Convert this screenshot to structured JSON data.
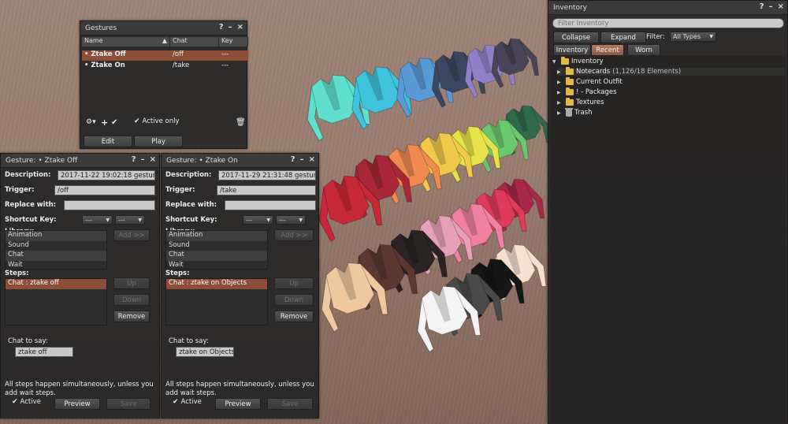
{
  "gestures_window": {
    "title": "Gestures",
    "columns": [
      "Name",
      "Chat",
      "Key"
    ],
    "rows": [
      {
        "name": "• Ztake Off",
        "chat": "/off",
        "key": "---"
      },
      {
        "name": "• Ztake On",
        "chat": "/take",
        "key": "---"
      }
    ],
    "active_only_label": "Active only",
    "edit_label": "Edit",
    "play_label": "Play"
  },
  "gesture_off": {
    "title": "Gesture: • Ztake Off",
    "description_label": "Description:",
    "description_value": "2017-11-22 19:02:18 gesture",
    "trigger_label": "Trigger:",
    "trigger_value": "/off",
    "replace_label": "Replace with:",
    "replace_value": "",
    "shortcut_label": "Shortcut Key:",
    "shortcut_mod": "---",
    "shortcut_key": "---",
    "library_label": "Library:",
    "library_items": [
      "Animation",
      "Sound",
      "Chat",
      "Wait"
    ],
    "add_label": "Add >>",
    "steps_label": "Steps:",
    "steps_items": [
      "Chat : ztake off"
    ],
    "up_label": "Up",
    "down_label": "Down",
    "remove_label": "Remove",
    "chat_to_say_label": "Chat to say:",
    "chat_to_say_value": "ztake off",
    "note": "All steps happen simultaneously, unless you add wait steps.",
    "active_label": "Active",
    "preview_label": "Preview",
    "save_label": "Save"
  },
  "gesture_on": {
    "title": "Gesture: • Ztake On",
    "description_label": "Description:",
    "description_value": "2017-11-29 21:31:48 gesture",
    "trigger_label": "Trigger:",
    "trigger_value": "/take",
    "replace_label": "Replace with:",
    "replace_value": "",
    "shortcut_label": "Shortcut Key:",
    "shortcut_mod": "---",
    "shortcut_key": "---",
    "library_label": "Library:",
    "library_items": [
      "Animation",
      "Sound",
      "Chat",
      "Wait"
    ],
    "add_label": "Add >>",
    "steps_label": "Steps:",
    "steps_items": [
      "Chat : ztake on Objects"
    ],
    "up_label": "Up",
    "down_label": "Down",
    "remove_label": "Remove",
    "chat_to_say_label": "Chat to say:",
    "chat_to_say_value": "ztake on Objects",
    "note": "All steps happen simultaneously, unless you add wait steps.",
    "active_label": "Active",
    "preview_label": "Preview",
    "save_label": "Save"
  },
  "inventory": {
    "title": "Inventory",
    "filter_placeholder": "Filter Inventory",
    "collapse_label": "Collapse",
    "expand_label": "Expand",
    "filter_label": "Filter:",
    "filter_value": "All Types",
    "tabs": [
      "Inventory",
      "Recent",
      "Worn"
    ],
    "root_label": "Inventory",
    "folders": [
      {
        "label": "Notecards",
        "extra": "(1,126/18 Elements)"
      },
      {
        "label": "Current Outfit",
        "extra": ""
      },
      {
        "label": "! - Packages",
        "extra": ""
      },
      {
        "label": "Textures",
        "extra": ""
      },
      {
        "label": "Trash",
        "extra": ""
      }
    ]
  },
  "colors": {
    "selection": "#8d4e37",
    "window_bg": "#262626",
    "folder": "#e1b847"
  }
}
